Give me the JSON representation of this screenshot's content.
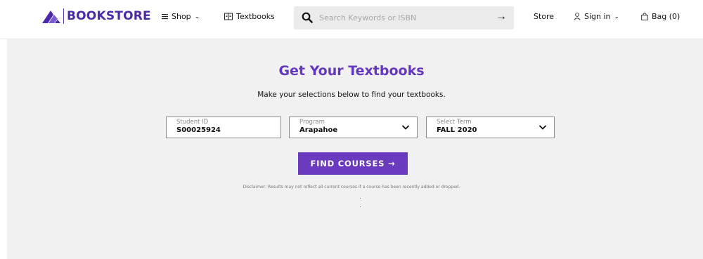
{
  "header": {
    "logo_text": "BOOKSTORE",
    "shop_label": "Shop",
    "textbooks_label": "Textbooks",
    "search_placeholder": "Search Keywords or ISBN",
    "store_label": "Store",
    "signin_label": "Sign in",
    "bag_label": "Bag (0)"
  },
  "main": {
    "title": "Get Your Textbooks",
    "subtitle": "Make your selections below to find your textbooks.",
    "fields": {
      "student_id": {
        "label": "Student ID",
        "value": "S00025924"
      },
      "program": {
        "label": "Program",
        "value": "Arapahoe"
      },
      "term": {
        "label": "Select Term",
        "value": "FALL 2020"
      }
    },
    "find_button": "FIND COURSES →",
    "disclaimer": "Disclaimer: Results may not reflect all current courses if a course has been recently added or dropped."
  },
  "colors": {
    "brand": "#4b2aa8",
    "title": "#6438be",
    "button": "#6a3bbf",
    "panel_bg": "#f1f1f1"
  },
  "icons": [
    "bookstore-logo-icon",
    "menu-lines-icon",
    "book-icon",
    "search-icon",
    "arrow-right-icon",
    "user-icon",
    "bag-icon",
    "chevron-down-icon"
  ]
}
